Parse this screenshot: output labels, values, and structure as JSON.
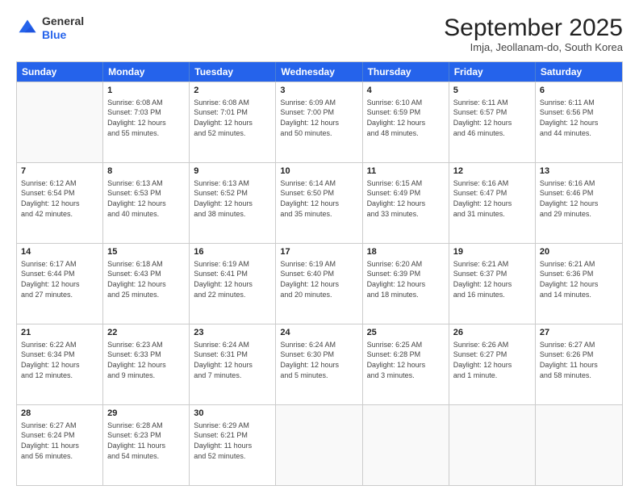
{
  "logo": {
    "general": "General",
    "blue": "Blue"
  },
  "header": {
    "month": "September 2025",
    "location": "Imja, Jeollanam-do, South Korea"
  },
  "weekdays": [
    "Sunday",
    "Monday",
    "Tuesday",
    "Wednesday",
    "Thursday",
    "Friday",
    "Saturday"
  ],
  "weeks": [
    [
      {
        "day": "",
        "info": ""
      },
      {
        "day": "1",
        "info": "Sunrise: 6:08 AM\nSunset: 7:03 PM\nDaylight: 12 hours\nand 55 minutes."
      },
      {
        "day": "2",
        "info": "Sunrise: 6:08 AM\nSunset: 7:01 PM\nDaylight: 12 hours\nand 52 minutes."
      },
      {
        "day": "3",
        "info": "Sunrise: 6:09 AM\nSunset: 7:00 PM\nDaylight: 12 hours\nand 50 minutes."
      },
      {
        "day": "4",
        "info": "Sunrise: 6:10 AM\nSunset: 6:59 PM\nDaylight: 12 hours\nand 48 minutes."
      },
      {
        "day": "5",
        "info": "Sunrise: 6:11 AM\nSunset: 6:57 PM\nDaylight: 12 hours\nand 46 minutes."
      },
      {
        "day": "6",
        "info": "Sunrise: 6:11 AM\nSunset: 6:56 PM\nDaylight: 12 hours\nand 44 minutes."
      }
    ],
    [
      {
        "day": "7",
        "info": "Sunrise: 6:12 AM\nSunset: 6:54 PM\nDaylight: 12 hours\nand 42 minutes."
      },
      {
        "day": "8",
        "info": "Sunrise: 6:13 AM\nSunset: 6:53 PM\nDaylight: 12 hours\nand 40 minutes."
      },
      {
        "day": "9",
        "info": "Sunrise: 6:13 AM\nSunset: 6:52 PM\nDaylight: 12 hours\nand 38 minutes."
      },
      {
        "day": "10",
        "info": "Sunrise: 6:14 AM\nSunset: 6:50 PM\nDaylight: 12 hours\nand 35 minutes."
      },
      {
        "day": "11",
        "info": "Sunrise: 6:15 AM\nSunset: 6:49 PM\nDaylight: 12 hours\nand 33 minutes."
      },
      {
        "day": "12",
        "info": "Sunrise: 6:16 AM\nSunset: 6:47 PM\nDaylight: 12 hours\nand 31 minutes."
      },
      {
        "day": "13",
        "info": "Sunrise: 6:16 AM\nSunset: 6:46 PM\nDaylight: 12 hours\nand 29 minutes."
      }
    ],
    [
      {
        "day": "14",
        "info": "Sunrise: 6:17 AM\nSunset: 6:44 PM\nDaylight: 12 hours\nand 27 minutes."
      },
      {
        "day": "15",
        "info": "Sunrise: 6:18 AM\nSunset: 6:43 PM\nDaylight: 12 hours\nand 25 minutes."
      },
      {
        "day": "16",
        "info": "Sunrise: 6:19 AM\nSunset: 6:41 PM\nDaylight: 12 hours\nand 22 minutes."
      },
      {
        "day": "17",
        "info": "Sunrise: 6:19 AM\nSunset: 6:40 PM\nDaylight: 12 hours\nand 20 minutes."
      },
      {
        "day": "18",
        "info": "Sunrise: 6:20 AM\nSunset: 6:39 PM\nDaylight: 12 hours\nand 18 minutes."
      },
      {
        "day": "19",
        "info": "Sunrise: 6:21 AM\nSunset: 6:37 PM\nDaylight: 12 hours\nand 16 minutes."
      },
      {
        "day": "20",
        "info": "Sunrise: 6:21 AM\nSunset: 6:36 PM\nDaylight: 12 hours\nand 14 minutes."
      }
    ],
    [
      {
        "day": "21",
        "info": "Sunrise: 6:22 AM\nSunset: 6:34 PM\nDaylight: 12 hours\nand 12 minutes."
      },
      {
        "day": "22",
        "info": "Sunrise: 6:23 AM\nSunset: 6:33 PM\nDaylight: 12 hours\nand 9 minutes."
      },
      {
        "day": "23",
        "info": "Sunrise: 6:24 AM\nSunset: 6:31 PM\nDaylight: 12 hours\nand 7 minutes."
      },
      {
        "day": "24",
        "info": "Sunrise: 6:24 AM\nSunset: 6:30 PM\nDaylight: 12 hours\nand 5 minutes."
      },
      {
        "day": "25",
        "info": "Sunrise: 6:25 AM\nSunset: 6:28 PM\nDaylight: 12 hours\nand 3 minutes."
      },
      {
        "day": "26",
        "info": "Sunrise: 6:26 AM\nSunset: 6:27 PM\nDaylight: 12 hours\nand 1 minute."
      },
      {
        "day": "27",
        "info": "Sunrise: 6:27 AM\nSunset: 6:26 PM\nDaylight: 11 hours\nand 58 minutes."
      }
    ],
    [
      {
        "day": "28",
        "info": "Sunrise: 6:27 AM\nSunset: 6:24 PM\nDaylight: 11 hours\nand 56 minutes."
      },
      {
        "day": "29",
        "info": "Sunrise: 6:28 AM\nSunset: 6:23 PM\nDaylight: 11 hours\nand 54 minutes."
      },
      {
        "day": "30",
        "info": "Sunrise: 6:29 AM\nSunset: 6:21 PM\nDaylight: 11 hours\nand 52 minutes."
      },
      {
        "day": "",
        "info": ""
      },
      {
        "day": "",
        "info": ""
      },
      {
        "day": "",
        "info": ""
      },
      {
        "day": "",
        "info": ""
      }
    ]
  ]
}
